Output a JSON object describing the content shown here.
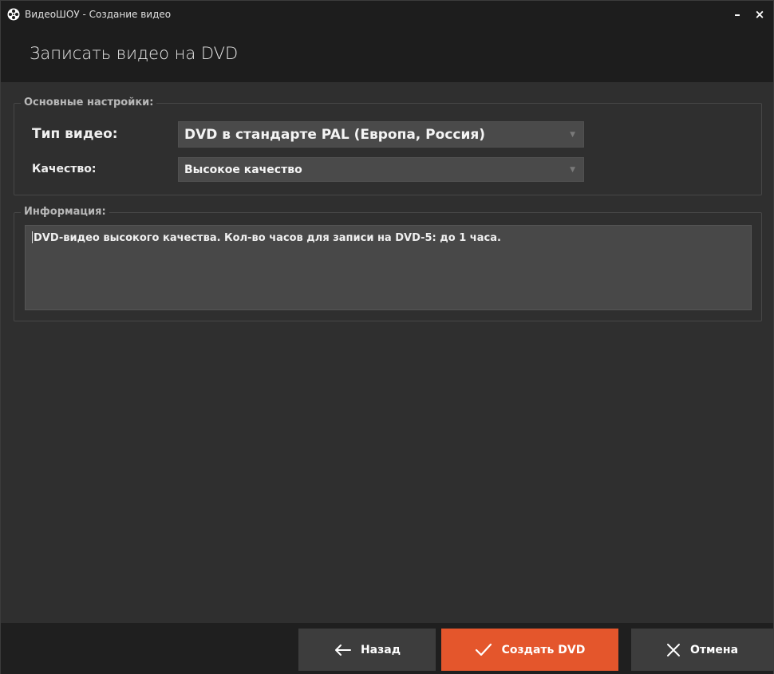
{
  "window": {
    "title": "ВидеоШОУ - Создание видео",
    "minimize_label": "–",
    "close_label": "×"
  },
  "header": {
    "title": "Записать видео на DVD"
  },
  "settings": {
    "legend": "Основные настройки:",
    "video_type": {
      "label": "Тип видео:",
      "value": "DVD в стандарте PAL (Европа, Россия)"
    },
    "quality": {
      "label": "Качество:",
      "value": "Высокое качество"
    }
  },
  "info": {
    "legend": "Информация:",
    "text": "DVD-видео высокого качества. Кол-во часов для записи на DVD-5: до 1 часа."
  },
  "footer": {
    "back_label": "Назад",
    "create_label": "Создать DVD",
    "cancel_label": "Отмена"
  },
  "colors": {
    "accent": "#e4562c",
    "titlebar": "#1d1d1d",
    "background": "#2f2f2f"
  },
  "icons": {
    "app": "film-reel-icon",
    "back": "arrow-left-icon",
    "create": "checkmark-icon",
    "cancel": "close-icon",
    "dropdown": "triangle-down-icon"
  }
}
